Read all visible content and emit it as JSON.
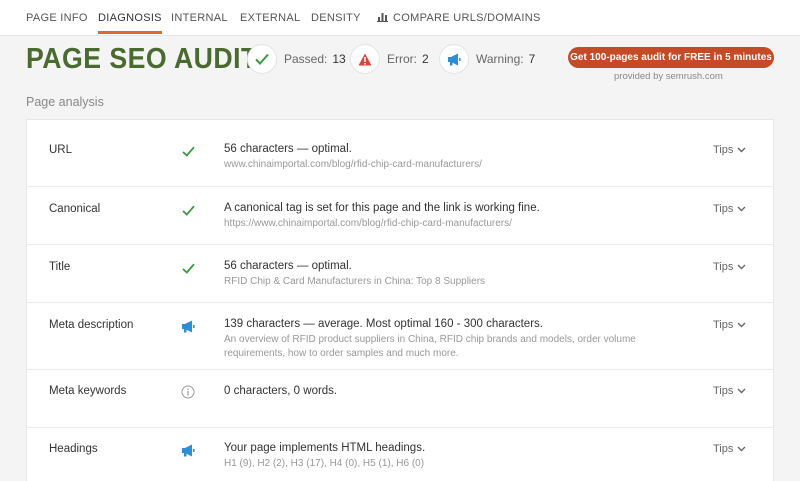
{
  "nav": {
    "tabs": [
      {
        "label": "PAGE INFO"
      },
      {
        "label": "DIAGNOSIS"
      },
      {
        "label": "INTERNAL"
      },
      {
        "label": "EXTERNAL"
      },
      {
        "label": "DENSITY"
      },
      {
        "label": "COMPARE URLS/DOMAINS",
        "icon": "bar-chart-icon"
      }
    ],
    "active_tab": "DIAGNOSIS"
  },
  "header": {
    "title": "PAGE SEO AUDIT",
    "stats": [
      {
        "label": "Passed:",
        "count": "13",
        "icon": "check-icon",
        "color": "#3a9a3a"
      },
      {
        "label": "Error:",
        "count": "2",
        "icon": "warning-triangle-icon",
        "color": "#e0403a"
      },
      {
        "label": "Warning:",
        "count": "7",
        "icon": "megaphone-icon",
        "color": "#2b8fd6"
      }
    ],
    "promo_button": "Get 100-pages audit for FREE in 5 minutes",
    "provided_by": "provided by  semrush.com"
  },
  "section_title": "Page analysis",
  "rows": [
    {
      "label": "URL",
      "status": "check-icon",
      "main": "56 characters — optimal.",
      "sub": "www.chinaimportal.com/blog/rfid-chip-card-manufacturers/",
      "tips": "Tips"
    },
    {
      "label": "Canonical",
      "status": "check-icon",
      "main": "A canonical tag is set for this page and the link is working fine.",
      "sub": "https://www.chinaimportal.com/blog/rfid-chip-card-manufacturers/",
      "tips": "Tips"
    },
    {
      "label": "Title",
      "status": "check-icon",
      "main": "56 characters — optimal.",
      "sub": "RFID Chip & Card Manufacturers in China: Top 8 Suppliers",
      "tips": "Tips"
    },
    {
      "label": "Meta description",
      "status": "megaphone-icon",
      "main": "139 characters — average. Most optimal 160 - 300 characters.",
      "sub": "An overview of RFID product suppliers in China, RFID chip brands and models, order volume requirements, how to order samples and much more.",
      "tips": "Tips"
    },
    {
      "label": "Meta keywords",
      "status": "info-icon",
      "main": "0 characters, 0 words.",
      "sub": "",
      "tips": "Tips"
    },
    {
      "label": "Headings",
      "status": "megaphone-icon",
      "main": "Your page implements HTML headings.",
      "sub": "H1 (9), H2 (2), H3 (17), H4 (0), H5 (1), H6 (0)",
      "tips": "Tips"
    }
  ],
  "colors": {
    "accent": "#e06a2b",
    "title_green": "#4a6b2e",
    "promo": "#c44b25",
    "check": "#3a9a3a",
    "error": "#e0403a",
    "warning": "#2b8fd6"
  }
}
